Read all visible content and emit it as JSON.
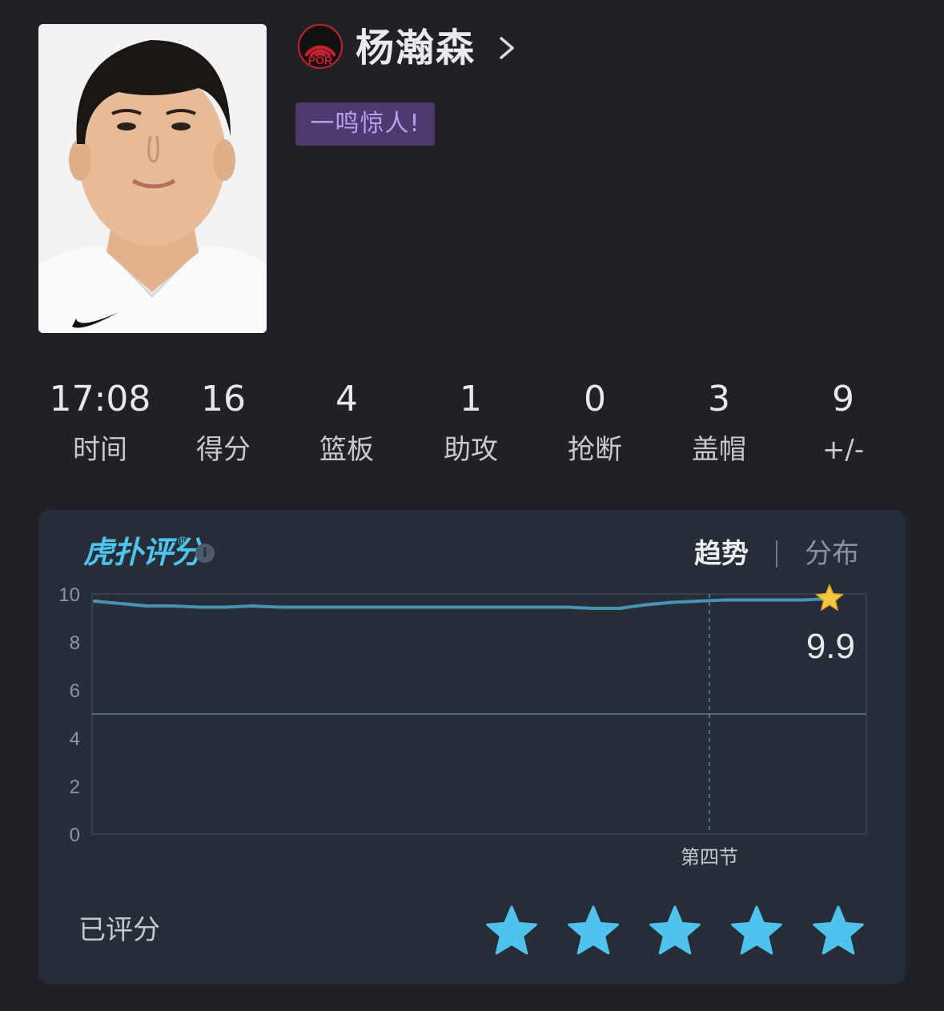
{
  "player": {
    "name": "杨瀚森",
    "tag": "一鸣惊人!",
    "team_logo_text": "POR"
  },
  "stats": [
    {
      "value": "17:08",
      "label": "时间"
    },
    {
      "value": "16",
      "label": "得分"
    },
    {
      "value": "4",
      "label": "篮板"
    },
    {
      "value": "1",
      "label": "助攻"
    },
    {
      "value": "0",
      "label": "抢断"
    },
    {
      "value": "3",
      "label": "盖帽"
    },
    {
      "value": "9",
      "label": "+/-"
    }
  ],
  "rating": {
    "brand": "虎扑评分",
    "brand_mark": "®",
    "info_icon": "i",
    "tabs": {
      "trend": "趋势",
      "distribution": "分布"
    },
    "rated_label": "已评分",
    "star_count": 5,
    "colors": {
      "line": "#4a93b5",
      "star": "#4fc3ec",
      "endpoint_star": "#f5c842",
      "brand": "#4fc3ec"
    }
  },
  "chart_data": {
    "type": "line",
    "title": "",
    "xlabel": "",
    "ylabel": "",
    "ylim": [
      0,
      10
    ],
    "yticks": [
      "0",
      "2",
      "4",
      "6",
      "8",
      "10"
    ],
    "quarter_marker": "第四节",
    "final_label": "9.9",
    "series": [
      {
        "values": [
          9.7,
          9.6,
          9.5,
          9.5,
          9.45,
          9.45,
          9.5,
          9.45,
          9.45,
          9.45,
          9.45,
          9.45,
          9.45,
          9.45,
          9.45,
          9.45,
          9.45,
          9.45,
          9.45,
          9.4,
          9.4,
          9.55,
          9.65,
          9.7,
          9.75,
          9.75,
          9.75,
          9.75,
          9.8
        ]
      }
    ]
  }
}
